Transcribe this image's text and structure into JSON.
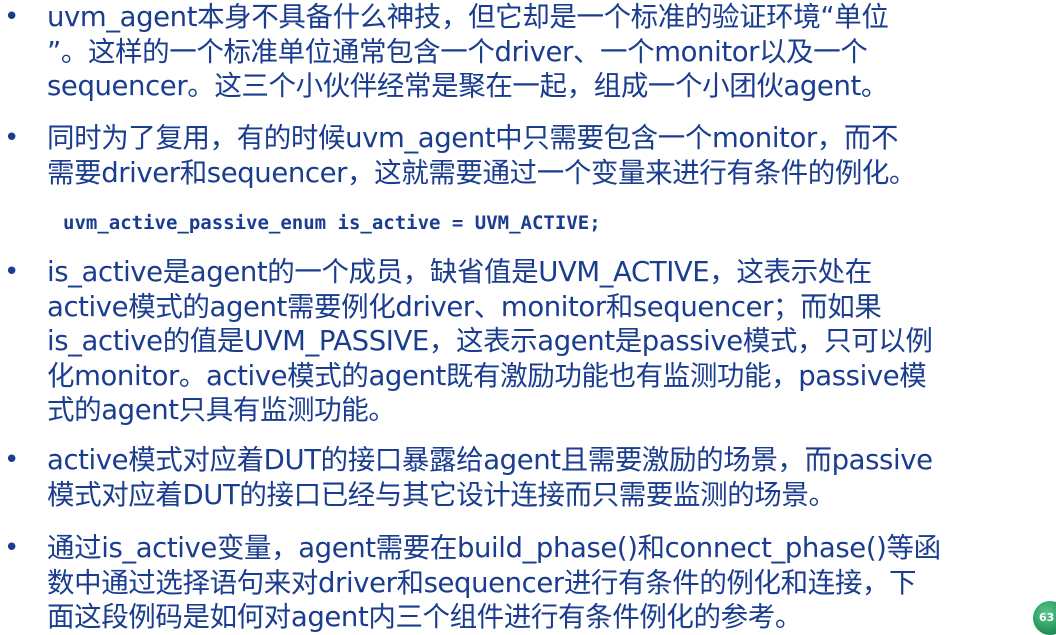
{
  "slide": {
    "bullet_symbol": "•",
    "bullets": [
      {
        "text": "uvm_agent本身不具备什么神技，但它却是一个标准的验证环境“单位\n”。这样的一个标准单位通常包含一个driver、一个monitor以及一个\nsequencer。这三个小伙伴经常是聚在一起，组成一个小团伙agent。"
      },
      {
        "text": "同时为了复用，有的时候uvm_agent中只需要包含一个monitor，而不\n需要driver和sequencer，这就需要通过一个变量来进行有条件的例化。"
      },
      {
        "text": "is_active是agent的一个成员，缺省值是UVM_ACTIVE，这表示处在\nactive模式的agent需要例化driver、monitor和sequencer；而如果\nis_active的值是UVM_PASSIVE，这表示agent是passive模式，只可以例\n化monitor。active模式的agent既有激励功能也有监测功能，passive模\n式的agent只具有监测功能。"
      },
      {
        "text": "active模式对应着DUT的接口暴露给agent且需要激励的场景，而passive\n模式对应着DUT的接口已经与其它设计连接而只需要监测的场景。"
      },
      {
        "text": "通过is_active变量，agent需要在build_phase()和connect_phase()等函\n数中通过选择语句来对driver和sequencer进行有条件的例化和连接，下\n面这段例码是如何对agent内三个组件进行有条件例化的参考。"
      }
    ],
    "code": "uvm_active_passive_enum is_active = UVM_ACTIVE;",
    "page_number": "63"
  },
  "colors": {
    "text": "#1a3d8f",
    "badge": "#1e8f57"
  }
}
